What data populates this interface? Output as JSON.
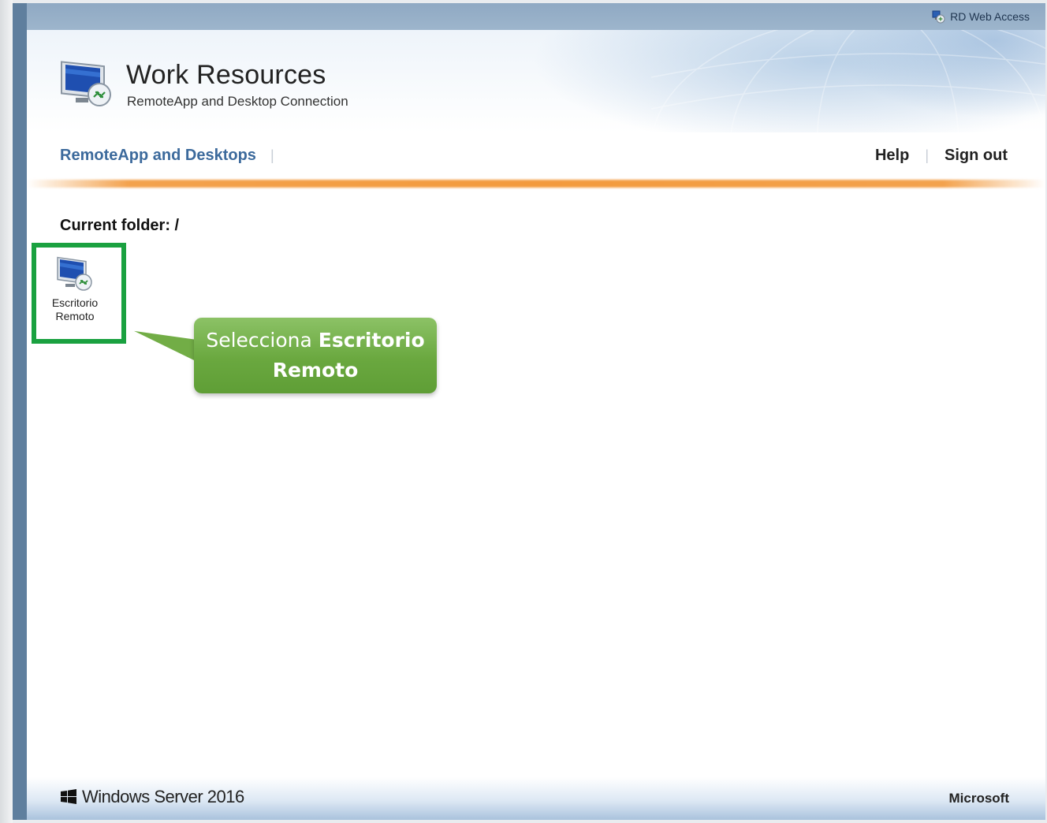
{
  "topbar": {
    "rdwa_label": "RD Web Access",
    "rdwa_icon": "rd-web-access-icon"
  },
  "header": {
    "title": "Work Resources",
    "subtitle": "RemoteApp and Desktop Connection",
    "logo_icon": "remote-desktop-monitor-icon"
  },
  "nav": {
    "section_label": "RemoteApp and Desktops",
    "help_label": "Help",
    "signout_label": "Sign out"
  },
  "content": {
    "current_folder": "Current folder: /",
    "resources": [
      {
        "label_line1": "Escritorio",
        "label_line2": "Remoto",
        "icon": "remote-desktop-icon"
      }
    ]
  },
  "callout": {
    "text_normal": "Selecciona",
    "text_bold1": "Escritorio",
    "text_bold2": "Remoto"
  },
  "footer": {
    "product": "Windows Server 2016",
    "vendor": "Microsoft"
  },
  "colors": {
    "nav_link": "#3c6a9c",
    "accent_orange": "#f39a3c",
    "callout_green": "#6aa83f",
    "highlight_green": "#1aa140"
  }
}
